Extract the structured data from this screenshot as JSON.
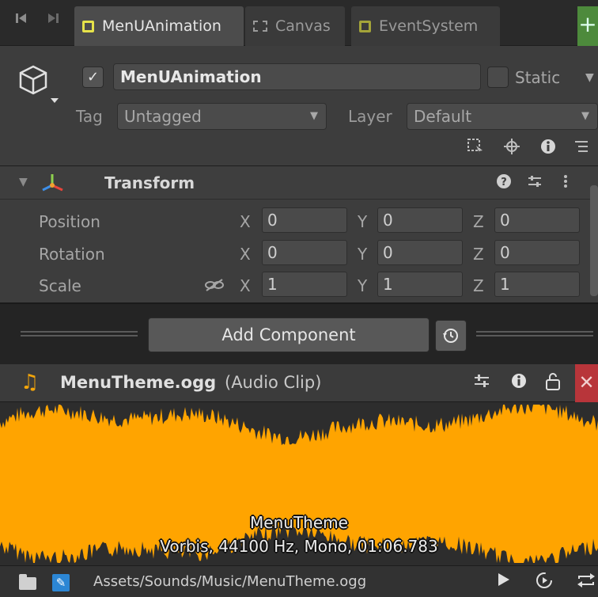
{
  "tabs": [
    {
      "label": "MenUAnimation",
      "active": true
    },
    {
      "label": "Canvas",
      "active": false
    },
    {
      "label": "EventSystem",
      "active": false
    }
  ],
  "tabbar": {
    "add_label": "+",
    "prev_icon": "step-back-icon",
    "next_icon": "step-forward-icon"
  },
  "gameobject": {
    "active": true,
    "active_mark": "✓",
    "name": "MenUAnimation",
    "static_label": "Static",
    "tag_label": "Tag",
    "tag_value": "Untagged",
    "layer_label": "Layer",
    "layer_value": "Default"
  },
  "transform": {
    "title": "Transform",
    "rows": [
      {
        "label": "Position",
        "x": "0",
        "y": "0",
        "z": "0"
      },
      {
        "label": "Rotation",
        "x": "0",
        "y": "0",
        "z": "0"
      },
      {
        "label": "Scale",
        "x": "1",
        "y": "1",
        "z": "1"
      }
    ],
    "axis_x": "X",
    "axis_y": "Y",
    "axis_z": "Z"
  },
  "add_component": {
    "label": "Add Component"
  },
  "clip": {
    "name": "MenuTheme.ogg",
    "type": "(Audio Clip)",
    "wave_title": "MenuTheme",
    "wave_info": "Vorbis, 44100 Hz, Mono, 01:06.783",
    "path": "Assets/Sounds/Music/MenuTheme.ogg"
  },
  "colors": {
    "waveform": "#ffa400",
    "close_button": "#b8353a",
    "gameobject_icon": "#e6e24a",
    "asset_icon": "#2c86d4"
  }
}
